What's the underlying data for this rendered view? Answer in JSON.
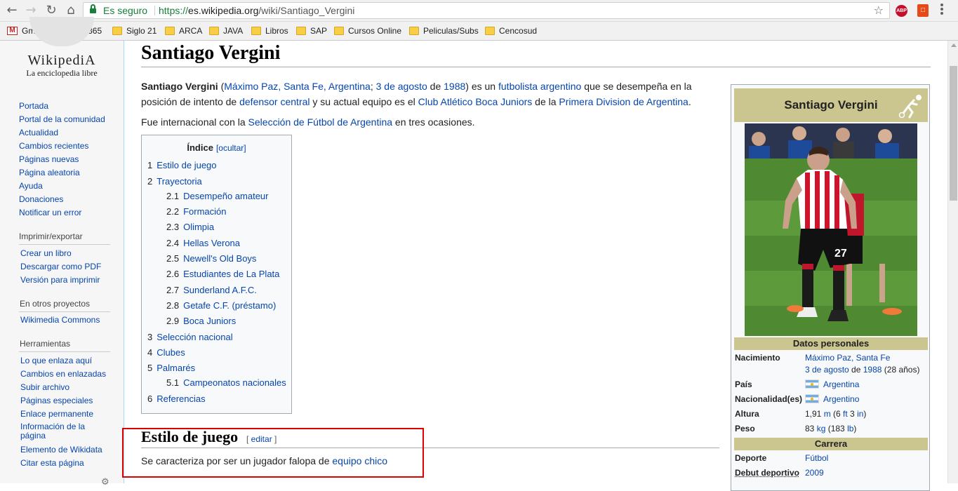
{
  "browser": {
    "secure_label": "Es seguro",
    "url_scheme": "https://",
    "url_host": "es.wikipedia.org",
    "url_path": "/wiki/Santiago_Vergini",
    "extensions": {
      "abp": "ABP"
    }
  },
  "bookmarks": [
    {
      "label": "Gmail",
      "icon": "gmail-icon"
    },
    {
      "label": "Office365",
      "icon": "microsoft-icon"
    },
    {
      "label": "Siglo 21",
      "icon": "folder-icon"
    },
    {
      "label": "ARCA",
      "icon": "folder-icon"
    },
    {
      "label": "JAVA",
      "icon": "folder-icon"
    },
    {
      "label": "Libros",
      "icon": "folder-icon"
    },
    {
      "label": "SAP",
      "icon": "folder-icon"
    },
    {
      "label": "Cursos Online",
      "icon": "folder-icon"
    },
    {
      "label": "Peliculas/Subs",
      "icon": "folder-icon"
    },
    {
      "label": "Cencosud",
      "icon": "folder-icon"
    }
  ],
  "sidebar": {
    "logo_word": "WikipediA",
    "logo_tagline": "La enciclopedia libre",
    "nav": [
      "Portada",
      "Portal de la comunidad",
      "Actualidad",
      "Cambios recientes",
      "Páginas nuevas",
      "Página aleatoria",
      "Ayuda",
      "Donaciones",
      "Notificar un error"
    ],
    "print_head": "Imprimir/exportar",
    "print": [
      "Crear un libro",
      "Descargar como PDF",
      "Versión para imprimir"
    ],
    "projects_head": "En otros proyectos",
    "projects": [
      "Wikimedia Commons"
    ],
    "tools_head": "Herramientas",
    "tools": [
      "Lo que enlaza aquí",
      "Cambios en enlazadas",
      "Subir archivo",
      "Páginas especiales",
      "Enlace permanente",
      "Información de la",
      "página",
      "Elemento de Wikidata",
      "Citar esta página"
    ]
  },
  "article": {
    "title": "Santiago Vergini",
    "intro": {
      "bold": "Santiago Vergini",
      "paren_open": " (",
      "birthplace": "Máximo Paz, Santa Fe, Argentina",
      "sep": "; ",
      "birthday": "3 de agosto",
      "de": " de ",
      "year": "1988",
      "mid1": ") es un ",
      "profession": "futbolista argentino",
      "mid2": " que se desempeña en la posición de intento de ",
      "position": "defensor central",
      "mid3": " y su actual equipo es el ",
      "club": "Club Atlético Boca Juniors",
      "mid4": " de la ",
      "league": "Primera Division de Argentina",
      "end": "."
    },
    "second": {
      "pre": "Fue internacional con la ",
      "team": "Selección de Fútbol de Argentina",
      "post": " en tres ocasiones."
    },
    "toc": {
      "title": "Índice",
      "toggle": "[ocultar]",
      "items": [
        {
          "num": "1",
          "label": "Estilo de juego"
        },
        {
          "num": "2",
          "label": "Trayectoria"
        },
        {
          "num": "2.1",
          "label": "Desempeño amateur"
        },
        {
          "num": "2.2",
          "label": "Formación"
        },
        {
          "num": "2.3",
          "label": "Olimpia"
        },
        {
          "num": "2.4",
          "label": "Hellas Verona"
        },
        {
          "num": "2.5",
          "label": "Newell's Old Boys"
        },
        {
          "num": "2.6",
          "label": "Estudiantes de La Plata"
        },
        {
          "num": "2.7",
          "label": "Sunderland A.F.C."
        },
        {
          "num": "2.8",
          "label": "Getafe C.F. (préstamo)"
        },
        {
          "num": "2.9",
          "label": "Boca Juniors"
        },
        {
          "num": "3",
          "label": "Selección nacional"
        },
        {
          "num": "4",
          "label": "Clubes"
        },
        {
          "num": "5",
          "label": "Palmarés"
        },
        {
          "num": "5.1",
          "label": "Campeonatos nacionales"
        },
        {
          "num": "6",
          "label": "Referencias"
        }
      ]
    },
    "section1": {
      "heading": "Estilo de juego",
      "edit_open": "[ ",
      "edit": "editar",
      "edit_close": " ]",
      "text_pre": "Se caracteriza por ser un jugador falopa de ",
      "text_link": "equipo chico"
    }
  },
  "infobox": {
    "title": "Santiago Vergini",
    "personal_head": "Datos personales",
    "nacimiento_label": "Nacimiento",
    "nacimiento_place": "Máximo Paz, Santa Fe",
    "nacimiento_day": "3 de agosto",
    "nacimiento_de": " de ",
    "nacimiento_year": "1988",
    "nacimiento_age": " (28 años)",
    "pais_label": "País",
    "pais_value": "Argentina",
    "nac_label": "Nacionalidad(es)",
    "nac_value": "Argentino",
    "altura_label": "Altura",
    "altura_pre": "1,91 ",
    "altura_unit": "m",
    "altura_mid": " (6 ",
    "altura_ft": "ft",
    "altura_mid2": " 3 ",
    "altura_in": "in",
    "altura_end": ")",
    "peso_label": "Peso",
    "peso_pre": "83 ",
    "peso_unit": "kg",
    "peso_mid": " (183 ",
    "peso_lb": "lb",
    "peso_end": ")",
    "career_head": "Carrera",
    "deporte_label": "Deporte",
    "deporte_value": "Fútbol",
    "debut_label": "Debut deportivo",
    "debut_value": "2009"
  },
  "colors": {
    "link": "#0645ad",
    "infobox_header": "#cbc58f",
    "highlight": "#e00000"
  }
}
